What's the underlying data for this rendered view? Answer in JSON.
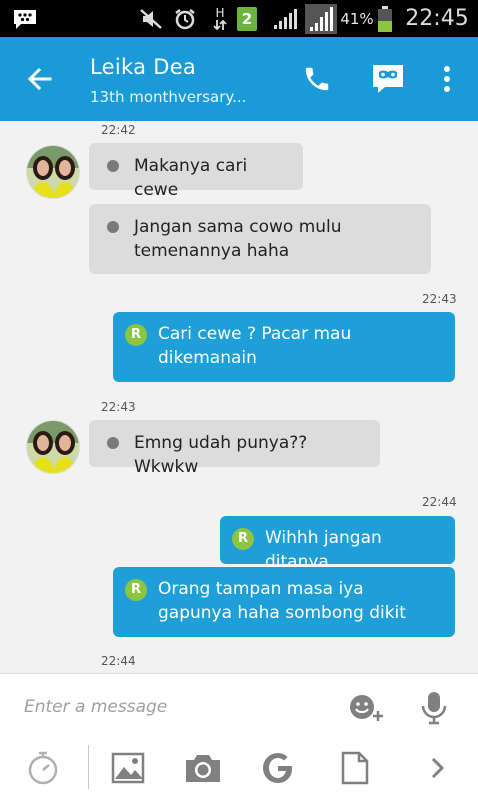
{
  "status_bar": {
    "battery_percent": "41%",
    "time": "22:45",
    "network_type": "H",
    "sim_badge": "2",
    "icons": [
      "bbm-notification-icon",
      "mute-icon",
      "alarm-icon",
      "data-arrows-icon",
      "signal-icon",
      "signal-icon-2",
      "battery-icon"
    ]
  },
  "header": {
    "contact_name": "Leika Dea",
    "status": "13th monthversary...",
    "icons": [
      "back-arrow-icon",
      "phone-icon",
      "video-call-icon",
      "more-vert-icon"
    ]
  },
  "messages": [
    {
      "type": "timestamp",
      "text": "22:42"
    },
    {
      "type": "incoming",
      "text": "Makanya cari cewe"
    },
    {
      "type": "incoming",
      "text": "Jangan sama cowo mulu temenannya haha"
    },
    {
      "type": "timestamp",
      "text": "22:43"
    },
    {
      "type": "outgoing",
      "badge": "R",
      "text": "Cari cewe ? Pacar mau dikemanain"
    },
    {
      "type": "timestamp",
      "text": "22:43"
    },
    {
      "type": "incoming",
      "text": "Emng udah punya?? Wkwkw"
    },
    {
      "type": "timestamp",
      "text": "22:44"
    },
    {
      "type": "outgoing",
      "badge": "R",
      "text": "Wihhh jangan ditanya"
    },
    {
      "type": "outgoing",
      "badge": "R",
      "text": "Orang tampan masa iya gapunya haha sombong dikit"
    },
    {
      "type": "timestamp",
      "text": "22:44"
    }
  ],
  "composer": {
    "placeholder": "Enter a message",
    "icons": [
      "emoji-add-icon",
      "microphone-icon"
    ]
  },
  "toolbar": {
    "icons": [
      "timer-icon",
      "image-icon",
      "camera-icon",
      "google-icon",
      "file-icon",
      "chevron-right-icon"
    ]
  },
  "colors": {
    "accent": "#1a9ad6",
    "outgoing_bubble": "#1e9fd8",
    "incoming_bubble": "#dcdcdc",
    "read_badge": "#8cc63f",
    "background": "#f2f2f2"
  }
}
